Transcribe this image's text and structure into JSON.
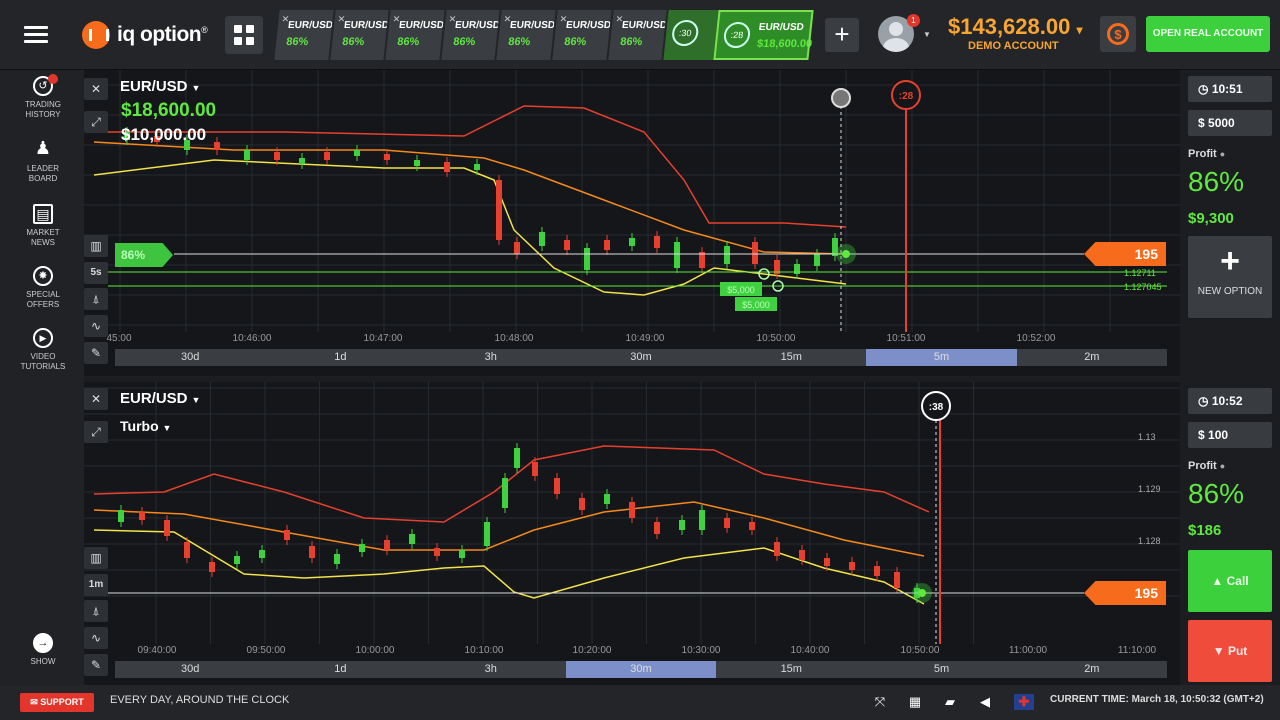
{
  "brand": {
    "name": "iq option",
    "mark": "®"
  },
  "tabs": [
    {
      "name": "EUR/USD",
      "pct": "86%"
    },
    {
      "name": "EUR/USD",
      "pct": "86%"
    },
    {
      "name": "EUR/USD",
      "pct": "86%"
    },
    {
      "name": "EUR/USD",
      "pct": "86%"
    },
    {
      "name": "EUR/USD",
      "pct": "86%"
    },
    {
      "name": "EUR/USD",
      "pct": "86%"
    },
    {
      "name": "EUR/USD",
      "pct": "86%"
    }
  ],
  "active_tab": {
    "timer": ":28",
    "timer2": ":30",
    "name": "EUR/USD",
    "amount": "$18,600.00"
  },
  "header": {
    "badge": "1",
    "balance": "$143,628.00",
    "balance_caret": "▾",
    "account_type": "DEMO ACCOUNT",
    "open_real": "OPEN REAL ACCOUNT",
    "add": "+"
  },
  "sidebar": [
    {
      "label1": "TRADING",
      "label2": "HISTORY",
      "icon": "history-icon",
      "glyph": "↺"
    },
    {
      "label1": "LEADER",
      "label2": "BOARD",
      "icon": "leaderboard-icon",
      "glyph": "♟"
    },
    {
      "label1": "MARKET",
      "label2": "NEWS",
      "icon": "news-icon",
      "glyph": "▤"
    },
    {
      "label1": "SPECIAL",
      "label2": "OFFERS",
      "icon": "offers-icon",
      "glyph": "✸"
    },
    {
      "label1": "VIDEO",
      "label2": "TUTORIALS",
      "icon": "video-icon",
      "glyph": "▶"
    },
    {
      "label1": "SHOW",
      "label2": "",
      "icon": "show-arrow-icon",
      "glyph": "→"
    }
  ],
  "chart1": {
    "asset": "EUR/USD",
    "amount_green": "$18,600.00",
    "amount_white": "$10,000.00",
    "interval": "5s",
    "timer": ":28",
    "price_tag": "195",
    "pct_tag": "86%",
    "price_labels": [
      "1.12711",
      "1.127045"
    ],
    "deals": [
      "$5,000",
      "$5,000"
    ],
    "time_labels": [
      "45:00",
      "10:46:00",
      "10:47:00",
      "10:48:00",
      "10:49:00",
      "10:50:00",
      "10:51:00",
      "10:52:00"
    ],
    "periods": [
      "30d",
      "1d",
      "3h",
      "30m",
      "15m",
      "5m",
      "2m"
    ],
    "selected_period": "5m"
  },
  "chart2": {
    "asset": "EUR/USD",
    "mode": "Turbo",
    "interval": "1m",
    "timer": ":38",
    "price_tag": "195",
    "price_labels": [
      "1.13",
      "1.129",
      "1.128"
    ],
    "time_labels": [
      "09:40:00",
      "09:50:00",
      "10:00:00",
      "10:10:00",
      "10:20:00",
      "10:30:00",
      "10:40:00",
      "10:50:00",
      "11:00:00",
      "11:10:00"
    ],
    "periods": [
      "30d",
      "1d",
      "3h",
      "30m",
      "15m",
      "5m",
      "2m"
    ],
    "selected_period": "30m"
  },
  "right1": {
    "time": "10:51",
    "amount": "5000",
    "profit_label": "Profit",
    "profit_pct": "86%",
    "profit_amount": "$9,300",
    "new_option": "NEW OPTION",
    "plus": "+"
  },
  "right2": {
    "time": "10:52",
    "amount": "100",
    "profit_label": "Profit",
    "profit_pct": "86%",
    "profit_amount": "$186",
    "call": "Call",
    "put": "Put"
  },
  "bottom": {
    "support": "SUPPORT",
    "tagline": "EVERY DAY, AROUND THE CLOCK",
    "current_time": "CURRENT TIME: March 18, 10:50:32 (GMT+2)"
  },
  "colors": {
    "green": "#5fe83f",
    "orange": "#f76b1c",
    "red": "#f04c3c",
    "gold": "#f9a531",
    "yellow": "#f2e34a"
  }
}
